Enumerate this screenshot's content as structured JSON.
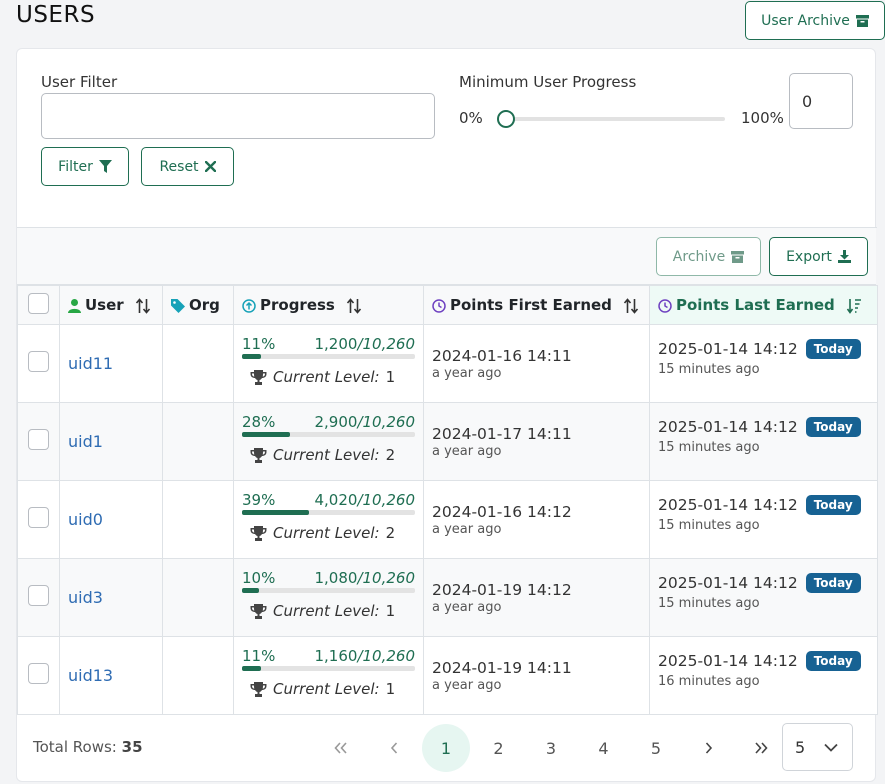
{
  "page": {
    "title": "USERS",
    "archive_button": "User Archive"
  },
  "filters": {
    "user_filter_label": "User Filter",
    "user_filter_value": "",
    "progress_label": "Minimum User Progress",
    "slider_min_label": "0%",
    "slider_max_label": "100%",
    "slider_value_fraction": 0,
    "min_progress_value": "0",
    "filter_button": "Filter",
    "reset_button": "Reset"
  },
  "toolbar": {
    "archive_button": "Archive",
    "export_button": "Export"
  },
  "columns": {
    "user": "User",
    "org": "Org",
    "progress": "Progress",
    "first_earned": "Points First Earned",
    "last_earned": "Points Last Earned"
  },
  "progress_text": {
    "level_label": "Current Level:"
  },
  "rows": [
    {
      "user": "uid11",
      "org": "",
      "percent": "11%",
      "points": "1,200",
      "total": "/10,260",
      "fraction": 0.11,
      "level": "1",
      "first": "2024-01-16 14:11",
      "first_ago": "a year ago",
      "last": "2025-01-14 14:12",
      "last_badge": "Today",
      "last_ago": "15 minutes ago"
    },
    {
      "user": "uid1",
      "org": "",
      "percent": "28%",
      "points": "2,900",
      "total": "/10,260",
      "fraction": 0.28,
      "level": "2",
      "first": "2024-01-17 14:11",
      "first_ago": "a year ago",
      "last": "2025-01-14 14:12",
      "last_badge": "Today",
      "last_ago": "15 minutes ago"
    },
    {
      "user": "uid0",
      "org": "",
      "percent": "39%",
      "points": "4,020",
      "total": "/10,260",
      "fraction": 0.39,
      "level": "2",
      "first": "2024-01-16 14:12",
      "first_ago": "a year ago",
      "last": "2025-01-14 14:12",
      "last_badge": "Today",
      "last_ago": "15 minutes ago"
    },
    {
      "user": "uid3",
      "org": "",
      "percent": "10%",
      "points": "1,080",
      "total": "/10,260",
      "fraction": 0.1,
      "level": "1",
      "first": "2024-01-19 14:12",
      "first_ago": "a year ago",
      "last": "2025-01-14 14:12",
      "last_badge": "Today",
      "last_ago": "15 minutes ago"
    },
    {
      "user": "uid13",
      "org": "",
      "percent": "11%",
      "points": "1,160",
      "total": "/10,260",
      "fraction": 0.11,
      "level": "1",
      "first": "2024-01-19 14:11",
      "first_ago": "a year ago",
      "last": "2025-01-14 14:12",
      "last_badge": "Today",
      "last_ago": "16 minutes ago"
    }
  ],
  "footer": {
    "total_label": "Total Rows:",
    "total_value": "35",
    "pages": [
      "1",
      "2",
      "3",
      "4",
      "5"
    ],
    "current_page": "1",
    "page_size": "5"
  },
  "colors": {
    "accent": "#1f6e52",
    "badge": "#176293",
    "link": "#2f6cb3"
  },
  "icons": [
    "archive-box-icon",
    "filter-funnel-icon",
    "close-x-icon",
    "download-icon",
    "user-icon",
    "tag-icon",
    "arrow-circle-up-icon",
    "clock-icon",
    "sort-arrows-icon",
    "sort-desc-icon",
    "trophy-icon",
    "chevron-down-icon"
  ]
}
